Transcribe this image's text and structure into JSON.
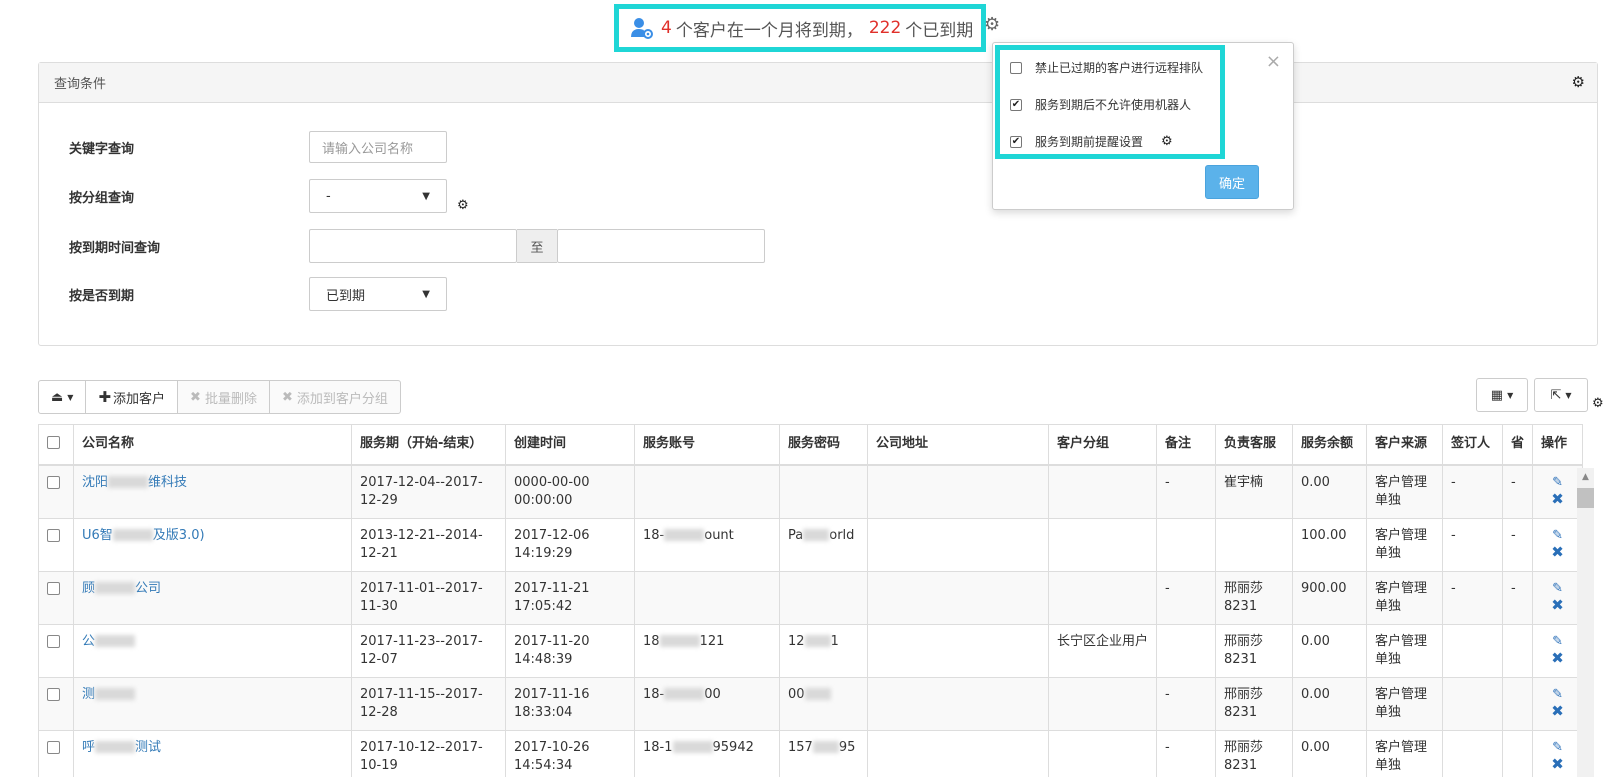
{
  "banner": {
    "count_soon": "4",
    "text_soon": "个客户在一个月将到期，",
    "count_expired": "222",
    "text_expired": "个已到期"
  },
  "panel": {
    "title": "查询条件",
    "keyword_label": "关键字查询",
    "keyword_placeholder": "请输入公司名称",
    "group_label": "按分组查询",
    "group_value": "-",
    "date_label": "按到期时间查询",
    "date_sep": "至",
    "expired_label": "按是否到期",
    "expired_value": "已到期"
  },
  "toolbar": {
    "add_customer": "添加客户",
    "batch_delete": "批量删除",
    "add_to_group": "添加到客户分组"
  },
  "table": {
    "headers": [
      "公司名称",
      "服务期（开始-结束）",
      "创建时间",
      "服务账号",
      "服务密码",
      "公司地址",
      "客户分组",
      "备注",
      "负责客服",
      "服务余额",
      "客户来源",
      "签订人",
      "省",
      "操作"
    ],
    "rows": [
      {
        "company_a": "沈阳",
        "company_b": "维科技",
        "period": "2017-12-04--2017-12-29",
        "created": "0000-00-00 00:00:00",
        "account_a": "",
        "account_b": "",
        "password_a": "",
        "password_b": "",
        "address": "",
        "group": "",
        "note": "-",
        "service": "崔宇楠",
        "balance": "0.00",
        "source": "客户管理单独",
        "signer": "-",
        "province": "-"
      },
      {
        "company_a": "U6智",
        "company_b": "及版3.0)",
        "period": "2013-12-21--2014-12-21",
        "created": "2017-12-06 14:19:29",
        "account_a": "18-",
        "account_b": "ount",
        "password_a": "Pa",
        "password_b": "orld",
        "address": "",
        "group": "",
        "note": "",
        "service": "",
        "balance": "100.00",
        "source": "客户管理单独",
        "signer": "-",
        "province": "-"
      },
      {
        "company_a": "顾",
        "company_b": "公司",
        "period": "2017-11-01--2017-11-30",
        "created": "2017-11-21 17:05:42",
        "account_a": "",
        "account_b": "",
        "password_a": "",
        "password_b": "",
        "address": "",
        "group": "",
        "note": "-",
        "service": "邢丽莎8231",
        "balance": "900.00",
        "source": "客户管理单独",
        "signer": "-",
        "province": "-"
      },
      {
        "company_a": "公",
        "company_b": "",
        "period": "2017-11-23--2017-12-07",
        "created": "2017-11-20 14:48:39",
        "account_a": "18",
        "account_b": "121",
        "password_a": "12",
        "password_b": "1",
        "address": "",
        "group": "长宁区企业用户",
        "note": "",
        "service": "邢丽莎8231",
        "balance": "0.00",
        "source": "客户管理单独",
        "signer": "",
        "province": ""
      },
      {
        "company_a": "测",
        "company_b": "",
        "period": "2017-11-15--2017-12-28",
        "created": "2017-11-16 18:33:04",
        "account_a": "18-",
        "account_b": "00",
        "password_a": "00",
        "password_b": "",
        "address": "",
        "group": "",
        "note": "-",
        "service": "邢丽莎8231",
        "balance": "0.00",
        "source": "客户管理单独",
        "signer": "",
        "province": ""
      },
      {
        "company_a": "呼",
        "company_b": "测试",
        "period": "2017-10-12--2017-10-19",
        "created": "2017-10-26 14:54:34",
        "account_a": "18-1",
        "account_b": "95942",
        "password_a": "157",
        "password_b": "95",
        "address": "",
        "group": "",
        "note": "-",
        "service": "邢丽莎8231",
        "balance": "0.00",
        "source": "客户管理单独",
        "signer": "",
        "province": ""
      }
    ]
  },
  "popup": {
    "options": [
      {
        "label": "禁止已过期的客户进行远程排队",
        "checked": false
      },
      {
        "label": "服务到期后不允许使用机器人",
        "checked": true
      },
      {
        "label": "服务到期前提醒设置",
        "checked": true
      }
    ],
    "confirm": "确定",
    "close": "×"
  },
  "colors": {
    "accent": "#1fd6d6",
    "count": "#e0302a",
    "link": "#337ab7",
    "button": "#5bb2ea"
  }
}
